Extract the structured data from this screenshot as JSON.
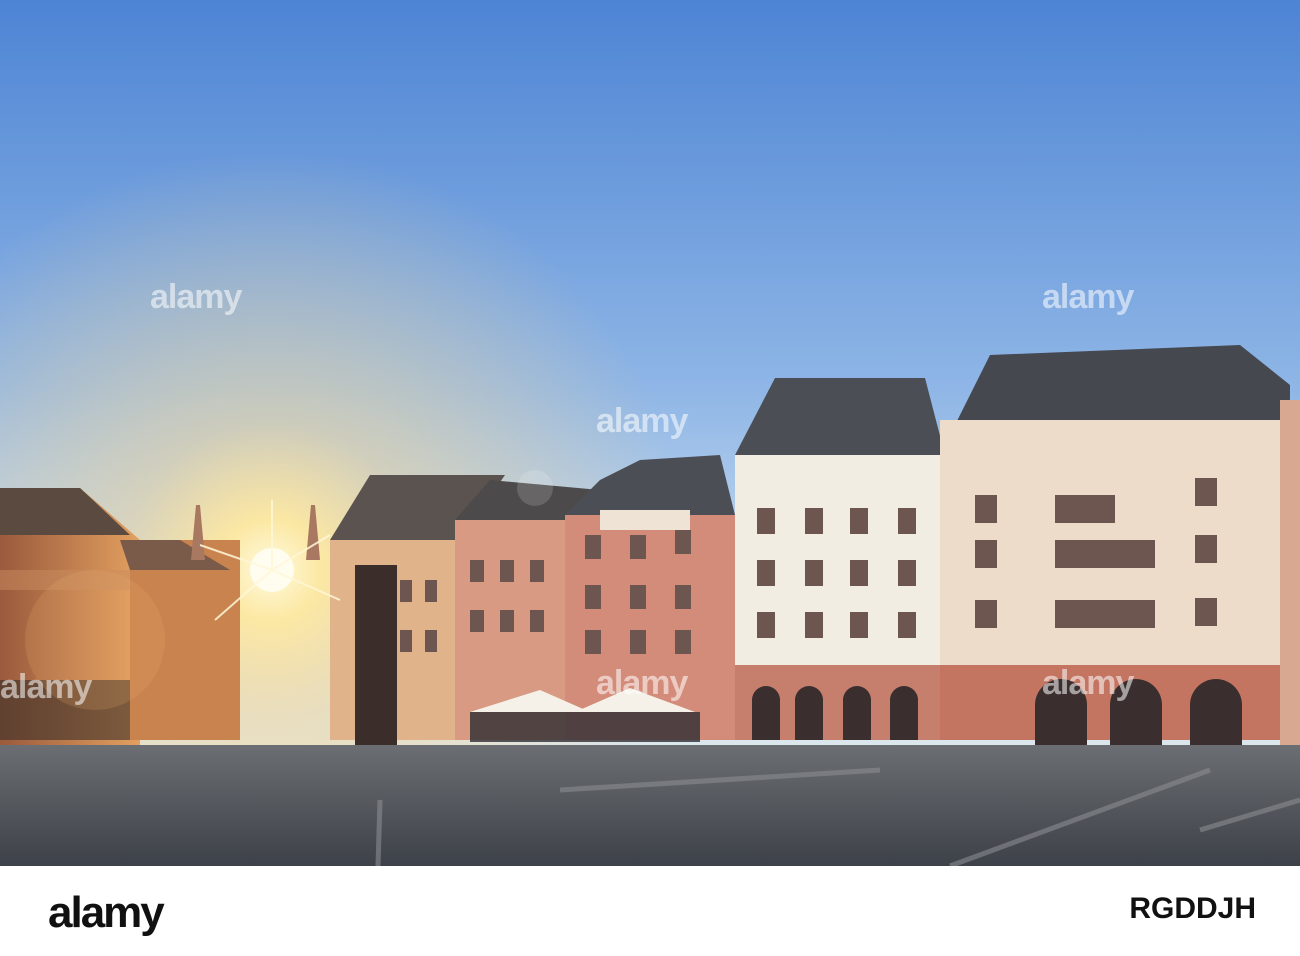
{
  "watermark": {
    "text": "alamy"
  },
  "footer": {
    "logo": "alamy",
    "image_id": "RGDDJH"
  },
  "colors": {
    "sky_top": "#4f86d6",
    "sky_low": "#d6e6f2",
    "sun": "#fff6c8",
    "pavement": "#5b5f66",
    "facade_pink": "#d88f7b",
    "facade_white": "#efece1",
    "roof": "#4b4e55"
  }
}
